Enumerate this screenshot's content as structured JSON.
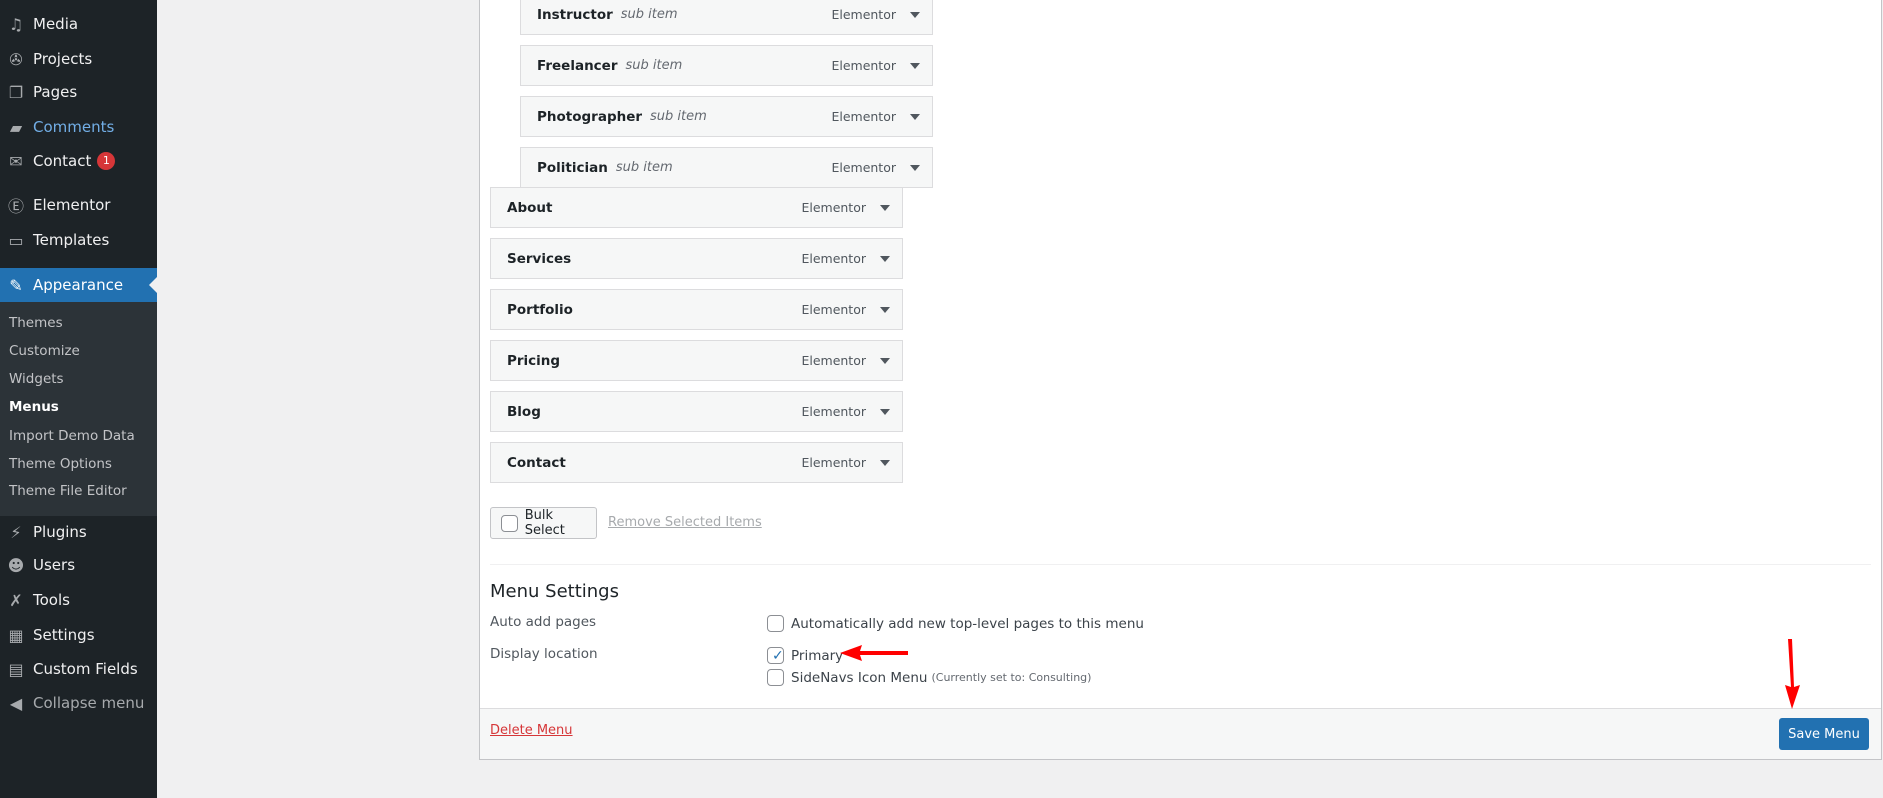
{
  "sidebar": {
    "items": [
      {
        "label": "Media",
        "icon": "media-icon"
      },
      {
        "label": "Projects",
        "icon": "projects-icon"
      },
      {
        "label": "Pages",
        "icon": "pages-icon"
      },
      {
        "label": "Comments",
        "icon": "comments-icon"
      },
      {
        "label": "Contact",
        "icon": "mail-icon",
        "badge": "1"
      },
      {
        "label": "Elementor",
        "icon": "elementor-icon"
      },
      {
        "label": "Templates",
        "icon": "folder-icon"
      },
      {
        "label": "Appearance",
        "icon": "paintbrush-icon"
      },
      {
        "label": "Plugins",
        "icon": "plugin-icon"
      },
      {
        "label": "Users",
        "icon": "users-icon"
      },
      {
        "label": "Tools",
        "icon": "wrench-icon"
      },
      {
        "label": "Settings",
        "icon": "settings-icon"
      },
      {
        "label": "Custom Fields",
        "icon": "table-icon"
      },
      {
        "label": "Collapse menu",
        "icon": "collapse-icon"
      }
    ],
    "submenu": [
      "Themes",
      "Customize",
      "Widgets",
      "Menus",
      "Import Demo Data",
      "Theme Options",
      "Theme File Editor"
    ]
  },
  "menu_items": {
    "sub_items": [
      {
        "label": "Instructor",
        "sub": "sub item",
        "type": "Elementor"
      },
      {
        "label": "Freelancer",
        "sub": "sub item",
        "type": "Elementor"
      },
      {
        "label": "Photographer",
        "sub": "sub item",
        "type": "Elementor"
      },
      {
        "label": "Politician",
        "sub": "sub item",
        "type": "Elementor"
      }
    ],
    "items": [
      {
        "label": "About",
        "type": "Elementor"
      },
      {
        "label": "Services",
        "type": "Elementor"
      },
      {
        "label": "Portfolio",
        "type": "Elementor"
      },
      {
        "label": "Pricing",
        "type": "Elementor"
      },
      {
        "label": "Blog",
        "type": "Elementor"
      },
      {
        "label": "Contact",
        "type": "Elementor"
      }
    ]
  },
  "bulk": {
    "select": "Bulk Select",
    "remove": "Remove Selected Items"
  },
  "settings": {
    "title": "Menu Settings",
    "auto_label": "Auto add pages",
    "auto_option": "Automatically add new top-level pages to this menu",
    "auto_checked": false,
    "display_label": "Display location",
    "primary": "Primary",
    "primary_checked": true,
    "sidenavs": "SideNavs Icon Menu",
    "sidenavs_note": "(Currently set to: Consulting)",
    "sidenavs_checked": false
  },
  "footer": {
    "delete": "Delete Menu",
    "save": "Save Menu"
  },
  "colors": {
    "accent": "#2271b1",
    "annotation_arrow": "#ff0000",
    "delete": "#d63638"
  }
}
